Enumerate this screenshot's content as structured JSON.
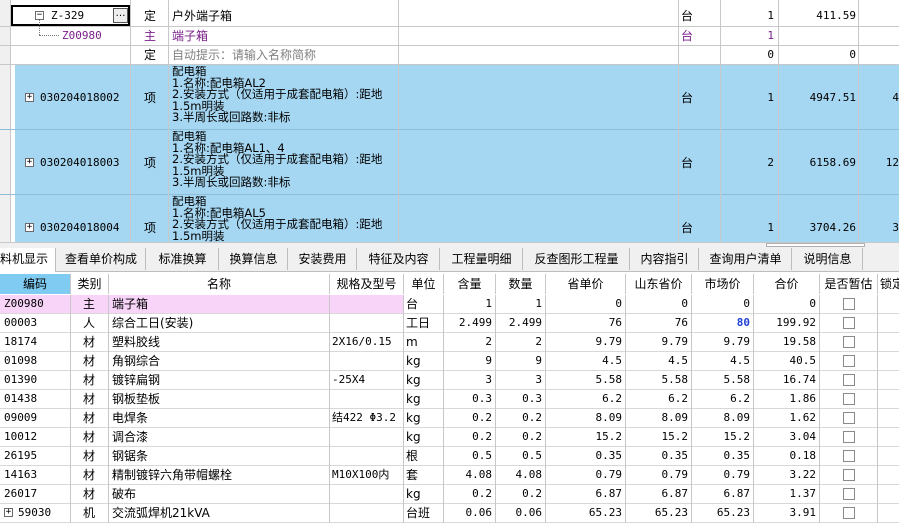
{
  "upper": {
    "row1": {
      "code": "Z-329",
      "type": "定",
      "name": "户外端子箱",
      "unit": "台",
      "qty": "1",
      "price": "411.59"
    },
    "row2": {
      "code": "Z00980",
      "type": "主",
      "name": "端子箱",
      "unit": "台",
      "qty": "1"
    },
    "row3": {
      "type": "定",
      "name": "自动提示：请输入名称简称",
      "qty": "0",
      "price": "0"
    },
    "row4": {
      "code": "030204018002",
      "type": "项",
      "desc": [
        "配电箱",
        "1.名称:配电箱AL2",
        "2.安装方式（仅适用于成套配电箱）:距地",
        "1.5m明装",
        "3.半周长或回路数:非标"
      ],
      "unit": "台",
      "qty": "1",
      "price": "4947.51",
      "extra": "4"
    },
    "row5": {
      "code": "030204018003",
      "type": "项",
      "desc": [
        "配电箱",
        "1.名称:配电箱AL1、4",
        "2.安装方式（仅适用于成套配电箱）:距地",
        "1.5m明装",
        "3.半周长或回路数:非标"
      ],
      "unit": "台",
      "qty": "2",
      "price": "6158.69",
      "extra": "12"
    },
    "row6": {
      "code": "030204018004",
      "type": "项",
      "desc": [
        "配电箱",
        "1.名称:配电箱AL5",
        "2.安装方式（仅适用于成套配电箱）:距地",
        "1.5m明装"
      ],
      "unit": "台",
      "qty": "1",
      "price": "3704.26",
      "extra": "3"
    }
  },
  "tabs": [
    "料机显示",
    "查看单价构成",
    "标准换算",
    "换算信息",
    "安装费用",
    "特征及内容",
    "工程量明细",
    "反查图形工程量",
    "内容指引",
    "查询用户清单",
    "说明信息"
  ],
  "headers": [
    "编码",
    "类别",
    "名称",
    "规格及型号",
    "单位",
    "含量",
    "数量",
    "省单价",
    "山东省价",
    "市场价",
    "合价",
    "是否暂估",
    "锁定"
  ],
  "rows": [
    {
      "code": "Z00980",
      "type": "主",
      "name": "端子箱",
      "spec": "",
      "unit": "台",
      "content": "1",
      "qty": "1",
      "prov": "0",
      "sd": "0",
      "market": "0",
      "total": "0"
    },
    {
      "code": "00003",
      "type": "人",
      "name": "综合工日(安装)",
      "spec": "",
      "unit": "工日",
      "content": "2.499",
      "qty": "2.499",
      "prov": "76",
      "sd": "76",
      "market": "80",
      "total": "199.92"
    },
    {
      "code": "18174",
      "type": "材",
      "name": "塑料胶线",
      "spec": "2X16/0.15",
      "unit": "m",
      "content": "2",
      "qty": "2",
      "prov": "9.79",
      "sd": "9.79",
      "market": "9.79",
      "total": "19.58"
    },
    {
      "code": "01098",
      "type": "材",
      "name": "角钢综合",
      "spec": "",
      "unit": "kg",
      "content": "9",
      "qty": "9",
      "prov": "4.5",
      "sd": "4.5",
      "market": "4.5",
      "total": "40.5"
    },
    {
      "code": "01390",
      "type": "材",
      "name": "镀锌扁钢",
      "spec": "-25X4",
      "unit": "kg",
      "content": "3",
      "qty": "3",
      "prov": "5.58",
      "sd": "5.58",
      "market": "5.58",
      "total": "16.74"
    },
    {
      "code": "01438",
      "type": "材",
      "name": "钢板垫板",
      "spec": "",
      "unit": "kg",
      "content": "0.3",
      "qty": "0.3",
      "prov": "6.2",
      "sd": "6.2",
      "market": "6.2",
      "total": "1.86"
    },
    {
      "code": "09009",
      "type": "材",
      "name": "电焊条",
      "spec": "结422 Φ3.2",
      "unit": "kg",
      "content": "0.2",
      "qty": "0.2",
      "prov": "8.09",
      "sd": "8.09",
      "market": "8.09",
      "total": "1.62"
    },
    {
      "code": "10012",
      "type": "材",
      "name": "调合漆",
      "spec": "",
      "unit": "kg",
      "content": "0.2",
      "qty": "0.2",
      "prov": "15.2",
      "sd": "15.2",
      "market": "15.2",
      "total": "3.04"
    },
    {
      "code": "26195",
      "type": "材",
      "name": "钢锯条",
      "spec": "",
      "unit": "根",
      "content": "0.5",
      "qty": "0.5",
      "prov": "0.35",
      "sd": "0.35",
      "market": "0.35",
      "total": "0.18"
    },
    {
      "code": "14163",
      "type": "材",
      "name": "精制镀锌六角带帽螺栓",
      "spec": "M10X100内",
      "unit": "套",
      "content": "4.08",
      "qty": "4.08",
      "prov": "0.79",
      "sd": "0.79",
      "market": "0.79",
      "total": "3.22"
    },
    {
      "code": "26017",
      "type": "材",
      "name": "破布",
      "spec": "",
      "unit": "kg",
      "content": "0.2",
      "qty": "0.2",
      "prov": "6.87",
      "sd": "6.87",
      "market": "6.87",
      "total": "1.37"
    },
    {
      "code": "59030",
      "type": "机",
      "name": "交流弧焊机21kVA",
      "spec": "",
      "unit": "台班",
      "content": "0.06",
      "qty": "0.06",
      "prov": "65.23",
      "sd": "65.23",
      "market": "65.23",
      "total": "3.91"
    }
  ],
  "colors": {
    "selected": "#a6d7f2",
    "highlight": "#f7d4f8",
    "header": "#fafafa",
    "tabbar": "#f0f0f0",
    "marketBlue": "#1f3fd3",
    "purple": "#7a1f8a"
  }
}
